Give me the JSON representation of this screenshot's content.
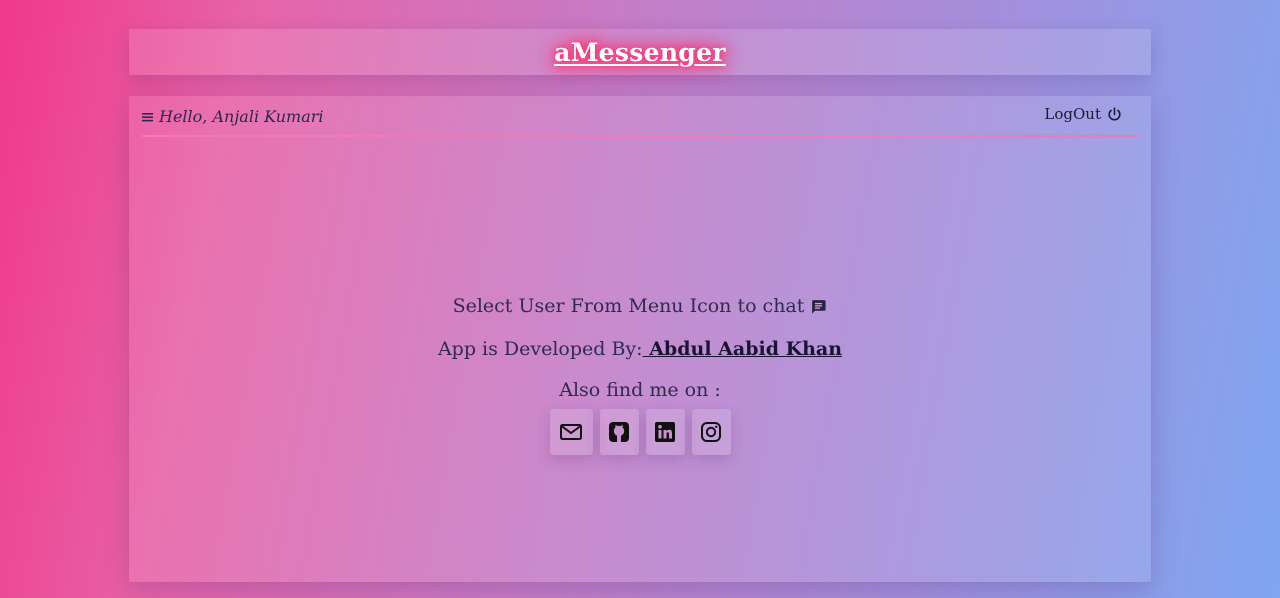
{
  "header": {
    "brand": "aMessenger"
  },
  "topbar": {
    "greeting": "Hello, Anjali Kumari",
    "logout_label": "LogOut",
    "divider_color": "#f07ab6"
  },
  "main": {
    "select_prompt": "Select User From Menu Icon to chat",
    "developer_prefix": "App is Developed By:",
    "developer_name": " Abdul Aabid Khan",
    "find_me": "Also find me on :",
    "socials": [
      {
        "name": "email",
        "icon": "mail-icon"
      },
      {
        "name": "github",
        "icon": "github-icon"
      },
      {
        "name": "linkedin",
        "icon": "linkedin-icon"
      },
      {
        "name": "instagram",
        "icon": "instagram-icon"
      }
    ]
  },
  "theme": {
    "gradient_start": "#f0388a",
    "gradient_end": "#7fa6f1",
    "brand_glow": "#ff2e6e"
  }
}
